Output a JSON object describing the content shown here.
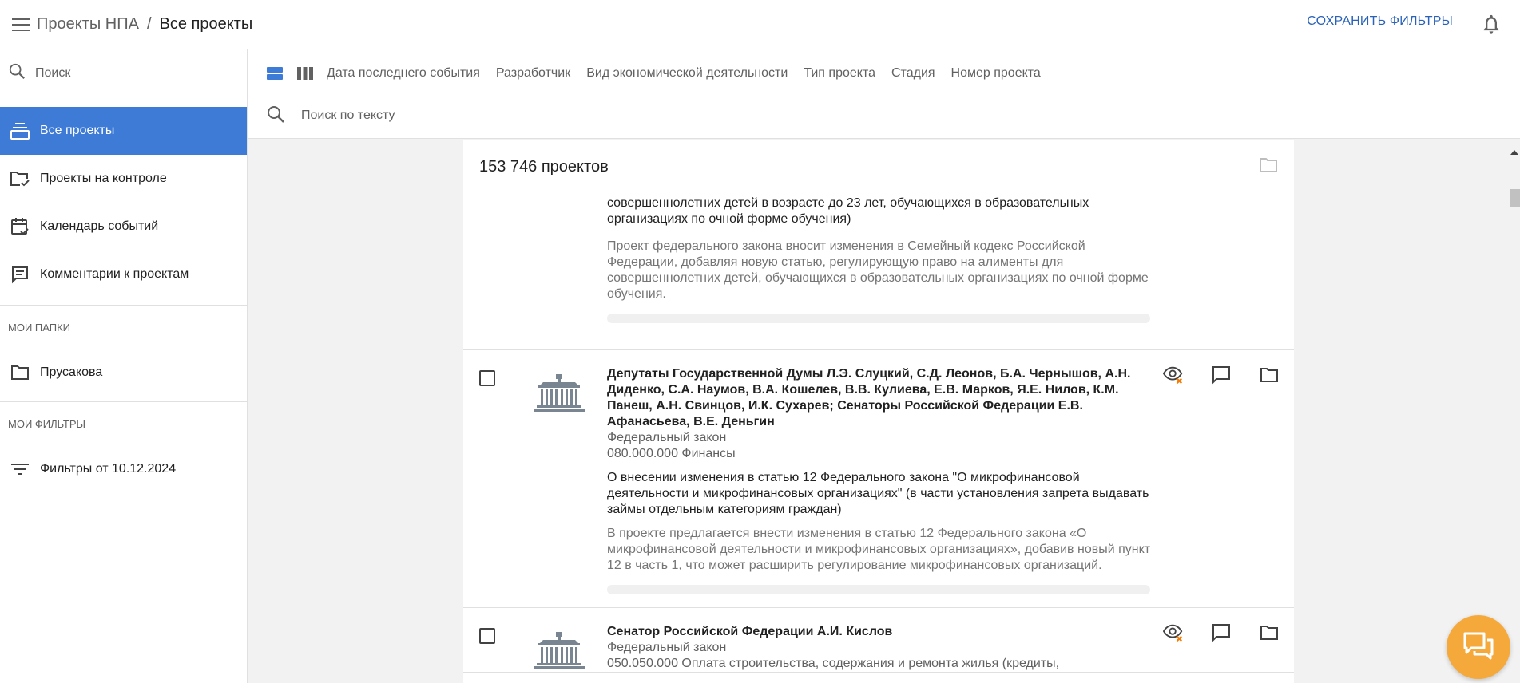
{
  "header": {
    "breadcrumb_root": "Проекты НПА",
    "breadcrumb_separator": "/",
    "breadcrumb_current": "Все проекты",
    "save_filters_label": "СОХРАНИТЬ ФИЛЬТРЫ"
  },
  "sidebar": {
    "search_placeholder": "Поиск",
    "nav": [
      {
        "label": "Все проекты",
        "active": true,
        "icon": "stack-icon"
      },
      {
        "label": "Проекты на контроле",
        "active": false,
        "icon": "folder-check-icon"
      },
      {
        "label": "Календарь событий",
        "active": false,
        "icon": "calendar-check-icon"
      },
      {
        "label": "Комментарии к проектам",
        "active": false,
        "icon": "comment-icon"
      }
    ],
    "folders_section": "МОИ ПАПКИ",
    "folders": [
      {
        "label": "Прусакова",
        "icon": "folder-icon"
      }
    ],
    "filters_section": "МОИ ФИЛЬТРЫ",
    "filters": [
      {
        "label": "Фильтры от 10.12.2024",
        "icon": "filter-list-icon"
      }
    ]
  },
  "filterbar": {
    "filters": [
      "Дата последнего события",
      "Разработчик",
      "Вид экономической деятельности",
      "Тип проекта",
      "Стадия",
      "Номер проекта"
    ],
    "text_search_placeholder": "Поиск по тексту"
  },
  "list": {
    "count_label": "153 746 проектов",
    "partial_card": {
      "title": "части установления обязанности по содержанию родителями и иными родственниками совершеннолетних детей в возрасте до 23 лет, обучающихся в образовательных организациях по очной форме обучения)",
      "summary": "Проект федерального закона вносит изменения в Семейный кодекс Российской Федерации, добавляя новую статью, регулирующую право на алименты для совершеннолетних детей, обучающихся в образовательных организациях по очной форме обучения."
    },
    "cards": [
      {
        "author": "Депутаты Государственной Думы Л.Э. Слуцкий, С.Д. Леонов, Б.А. Чернышов, А.Н. Диденко, С.А. Наумов, В.А. Кошелев, В.В. Кулиева, Е.В. Марков, Я.Е. Нилов, К.М. Панеш, А.Н. Свинцов, И.К. Сухарев; Сенаторы Российской Федерации Е.В. Афанасьева, В.Е. Деньгин",
        "type": "Федеральный закон",
        "category": "080.000.000 Финансы",
        "title": "О внесении изменения в статью 12 Федерального закона \"О микрофинансовой деятельности и микрофинансовых организациях\" (в части установления запрета выдавать займы отдельным категориям граждан)",
        "summary": "В проекте предлагается внести изменения в статью 12 Федерального закона «О микрофинансовой деятельности и микрофинансовых организациях», добавив новый пункт 12 в часть 1, что может расширить регулирование микрофинансовых организаций."
      },
      {
        "author": "Сенатор Российской Федерации А.И. Кислов",
        "type": "Федеральный закон",
        "category": "050.050.000 Оплата строительства, содержания и ремонта жилья (кредиты,",
        "title": "",
        "summary": ""
      }
    ]
  },
  "colors": {
    "accent": "#3d7bd6",
    "link": "#2962b8",
    "fab": "#f6a93b",
    "watch_off_badge": "#f57c00"
  }
}
